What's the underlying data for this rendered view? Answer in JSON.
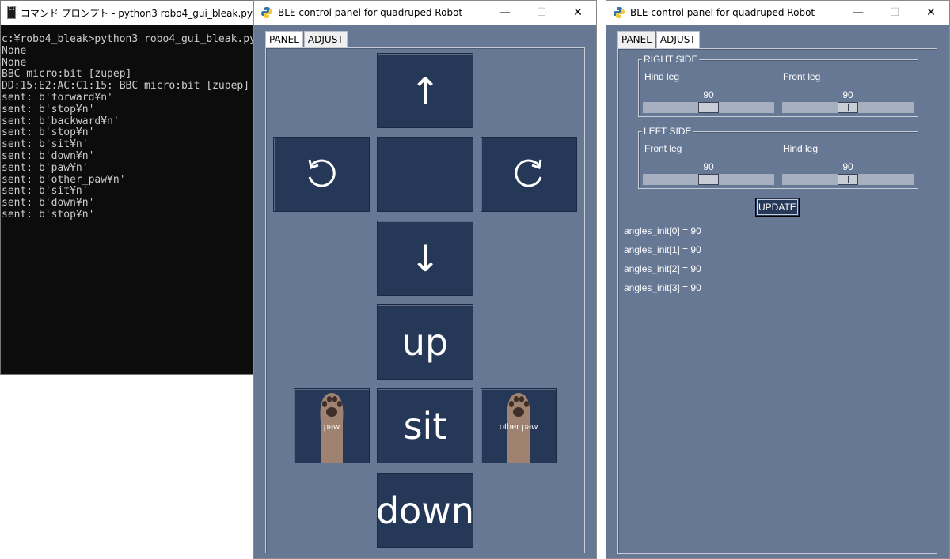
{
  "console": {
    "title": "コマンド プロンプト - python3  robo4_gui_bleak.py",
    "lines": [
      "c:¥robo4_bleak>python3 robo4_gui_bleak.py",
      "None",
      "None",
      "BBC micro:bit [zupep]",
      "DD:15:E2:AC:C1:15: BBC micro:bit [zupep]",
      "sent: b'forward¥n'",
      "sent: b'stop¥n'",
      "sent: b'backward¥n'",
      "sent: b'stop¥n'",
      "sent: b'sit¥n'",
      "sent: b'down¥n'",
      "sent: b'paw¥n'",
      "sent: b'other_paw¥n'",
      "sent: b'sit¥n'",
      "sent: b'down¥n'",
      "sent: b'stop¥n'"
    ]
  },
  "panel_window": {
    "title": "BLE control panel for quadruped Robot",
    "tabs": [
      "PANEL",
      "ADJUST"
    ],
    "buttons": {
      "forward": "↑",
      "rotate_left": "⟲",
      "rotate_right": "⟳",
      "backward": "↓",
      "up": "up",
      "paw": "paw",
      "sit": "sit",
      "other_paw": "other paw",
      "down": "down"
    }
  },
  "adjust_window": {
    "title": "BLE control panel for quadruped Robot",
    "tabs": [
      "PANEL",
      "ADJUST"
    ],
    "right_side": {
      "title": "RIGHT SIDE",
      "left_leg_label": "Hind leg",
      "right_leg_label": "Front leg",
      "left_value": "90",
      "right_value": "90"
    },
    "left_side": {
      "title": "LEFT SIDE",
      "left_leg_label": "Front leg",
      "right_leg_label": "Hind leg",
      "left_value": "90",
      "right_value": "90"
    },
    "update_label": "UPDATE",
    "angles": [
      "angles_init[0] = 90",
      "angles_init[1] = 90",
      "angles_init[2] = 90",
      "angles_init[3] = 90"
    ]
  },
  "window_controls": {
    "minimize": "—",
    "maximize": "☐",
    "close": "✕"
  },
  "colors": {
    "tk_background": "#667894",
    "button_background": "#263858",
    "console_background": "#0c0c0c",
    "paw_color": "#a08270"
  }
}
